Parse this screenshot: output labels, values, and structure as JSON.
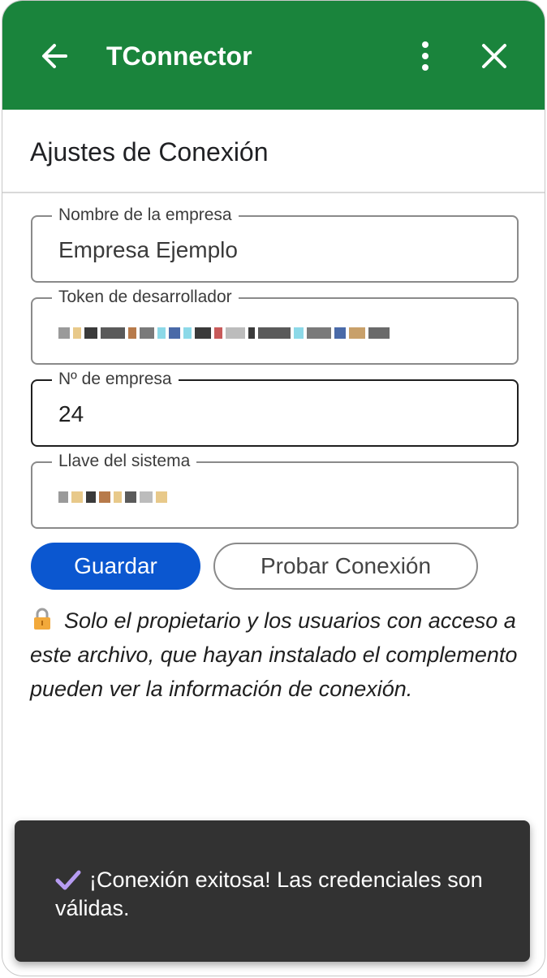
{
  "header": {
    "title": "TConnector",
    "back_icon": "arrow-left-icon",
    "menu_icon": "more-vertical-icon",
    "close_icon": "close-icon",
    "bg_color": "#1a843c"
  },
  "section": {
    "title": "Ajustes de Conexión"
  },
  "fields": [
    {
      "label": "Nombre de la empresa",
      "value": "Empresa Ejemplo"
    },
    {
      "label": "Token de desarrollador",
      "value": ""
    },
    {
      "label": "Nº de empresa",
      "value": "24"
    },
    {
      "label": "Llave del sistema",
      "value": ""
    }
  ],
  "buttons": {
    "save_label": "Guardar",
    "test_label": "Probar Conexión",
    "primary_color": "#0b57d0"
  },
  "notice": {
    "icon": "lock-icon",
    "text": "Solo el propietario y los usuarios con acceso a este archivo, que hayan instalado el complemento pueden ver la información de conexión."
  },
  "toast": {
    "icon": "check-icon",
    "text": "¡Conexión exitosa! Las credenciales son válidas."
  }
}
